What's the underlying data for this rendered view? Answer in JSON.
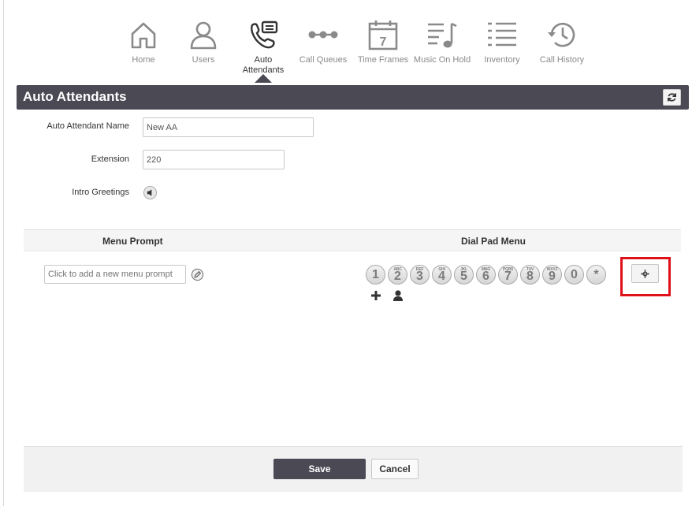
{
  "nav": {
    "items": [
      {
        "label": "Home",
        "icon": "home-icon"
      },
      {
        "label": "Users",
        "icon": "user-icon"
      },
      {
        "label": "Auto Attendants",
        "icon": "phone-attendant-icon",
        "active": true
      },
      {
        "label": "Call Queues",
        "icon": "queue-dots-icon"
      },
      {
        "label": "Time Frames",
        "icon": "calendar-icon"
      },
      {
        "label": "Music On Hold",
        "icon": "music-list-icon"
      },
      {
        "label": "Inventory",
        "icon": "list-icon"
      },
      {
        "label": "Call History",
        "icon": "history-icon"
      }
    ]
  },
  "header": {
    "title": "Auto Attendants",
    "refresh_icon": "refresh-icon"
  },
  "form": {
    "name_label": "Auto Attendant Name",
    "name_value": "New AA",
    "extension_label": "Extension",
    "extension_value": "220",
    "intro_label": "Intro Greetings"
  },
  "table": {
    "menu_prompt_header": "Menu Prompt",
    "dial_pad_header": "Dial Pad Menu",
    "prompt_placeholder": "Click to add a new menu prompt"
  },
  "keypad": [
    {
      "digit": "1",
      "letters": ""
    },
    {
      "digit": "2",
      "letters": "ABC"
    },
    {
      "digit": "3",
      "letters": "DEF"
    },
    {
      "digit": "4",
      "letters": "GHI"
    },
    {
      "digit": "5",
      "letters": "JKL"
    },
    {
      "digit": "6",
      "letters": "MNO"
    },
    {
      "digit": "7",
      "letters": "PQRS"
    },
    {
      "digit": "8",
      "letters": "TUV"
    },
    {
      "digit": "9",
      "letters": "WXYZ"
    },
    {
      "digit": "0",
      "letters": ""
    },
    {
      "digit": "*",
      "letters": ""
    }
  ],
  "colors": {
    "header_bg": "#4a4954",
    "highlight": "#e0101a"
  },
  "footer": {
    "save_label": "Save",
    "cancel_label": "Cancel"
  }
}
